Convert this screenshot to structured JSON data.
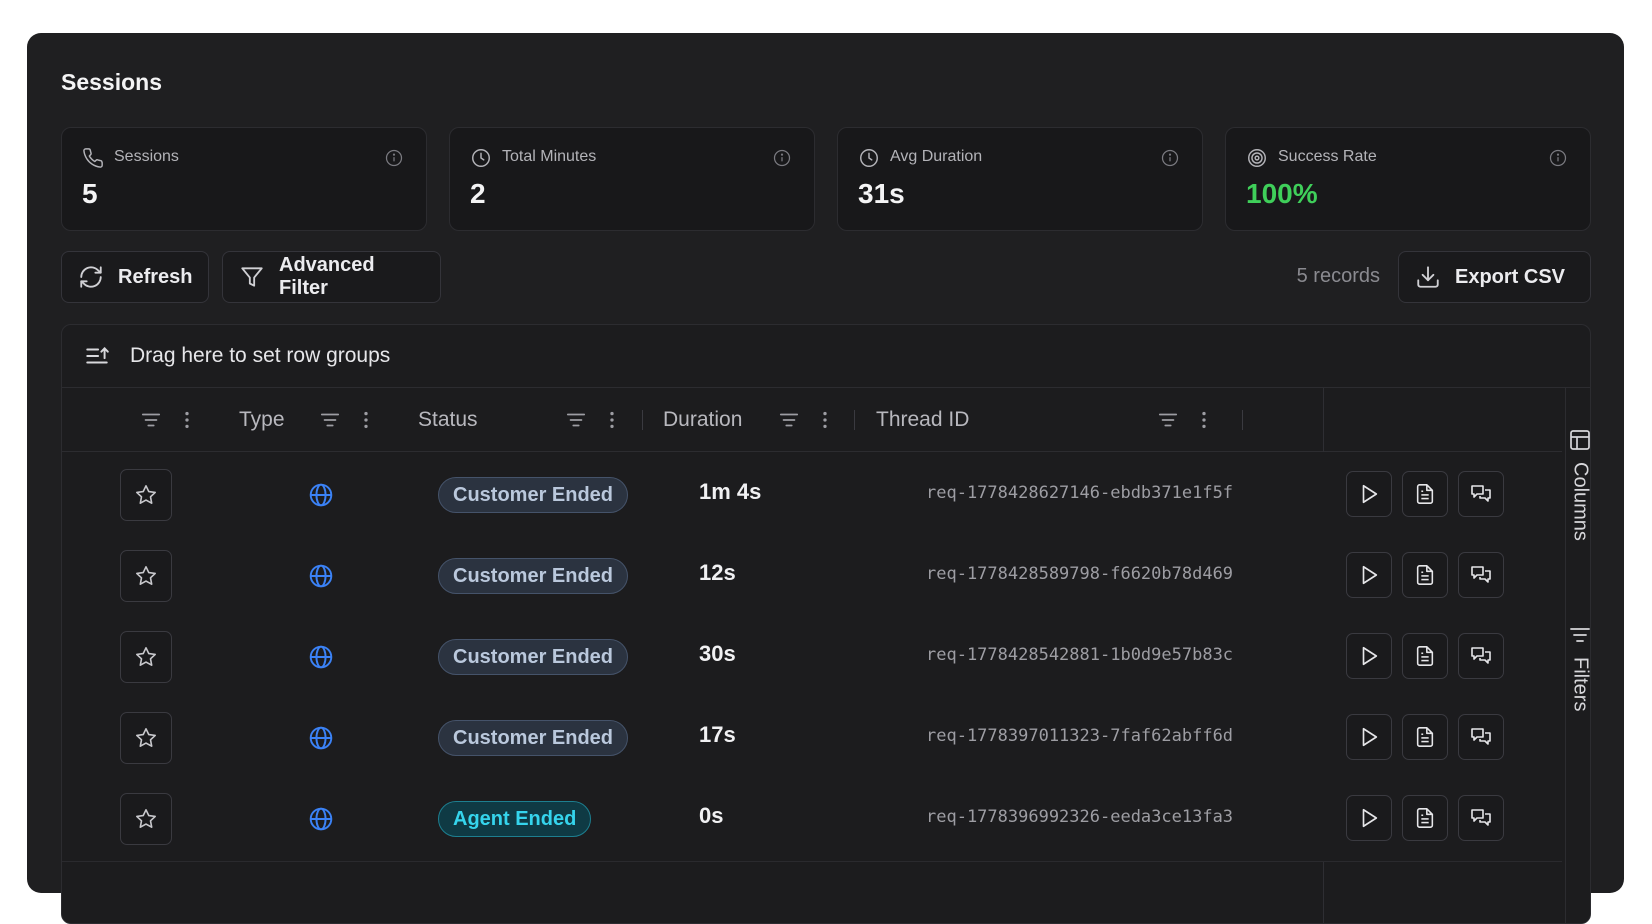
{
  "page": {
    "title": "Sessions"
  },
  "stats": [
    {
      "label": "Sessions",
      "value": "5",
      "icon": "phone-icon"
    },
    {
      "label": "Total Minutes",
      "value": "2",
      "icon": "clock-icon"
    },
    {
      "label": "Avg Duration",
      "value": "31s",
      "icon": "clock-icon"
    },
    {
      "label": "Success Rate",
      "value": "100%",
      "icon": "target-icon",
      "accent": "#3fcf5a"
    }
  ],
  "toolbar": {
    "refresh_label": "Refresh",
    "filter_label": "Advanced Filter",
    "records_text": "5 records",
    "export_label": "Export CSV"
  },
  "grid": {
    "group_bar_text": "Drag here to set row groups",
    "columns": [
      "Type",
      "Status",
      "Duration",
      "Thread ID"
    ],
    "rows": [
      {
        "status": "Customer Ended",
        "status_kind": "customer",
        "duration": "1m 4s",
        "thread_id": "req-1778428627146-ebdb371e1f5f"
      },
      {
        "status": "Customer Ended",
        "status_kind": "customer",
        "duration": "12s",
        "thread_id": "req-1778428589798-f6620b78d469"
      },
      {
        "status": "Customer Ended",
        "status_kind": "customer",
        "duration": "30s",
        "thread_id": "req-1778428542881-1b0d9e57b83c"
      },
      {
        "status": "Customer Ended",
        "status_kind": "customer",
        "duration": "17s",
        "thread_id": "req-1778397011323-7faf62abff6d"
      },
      {
        "status": "Agent Ended",
        "status_kind": "agent",
        "duration": "0s",
        "thread_id": "req-1778396992326-eeda3ce13fa3"
      }
    ]
  },
  "side_panel": {
    "columns_label": "Columns",
    "filters_label": "Filters"
  },
  "colors": {
    "accent_blue": "#3b82f6",
    "success_green": "#3fcf5a",
    "agent_cyan": "#35d4ec"
  }
}
